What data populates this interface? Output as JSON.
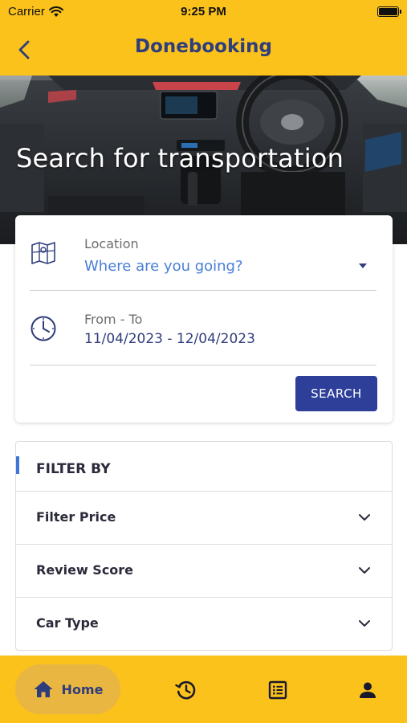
{
  "status_bar": {
    "carrier": "Carrier",
    "time": "9:25 PM"
  },
  "app_bar": {
    "title": "Donebooking",
    "back_icon": "chevron-left-icon"
  },
  "hero": {
    "title": "Search for transportation"
  },
  "search": {
    "location": {
      "label": "Location",
      "placeholder": "Where are you going?",
      "icon": "map-icon"
    },
    "dates": {
      "label": "From - To",
      "value": "11/04/2023 - 12/04/2023",
      "icon": "clock-icon"
    },
    "button_label": "SEARCH"
  },
  "filters": {
    "title": "FILTER BY",
    "items": [
      {
        "label": "Filter Price"
      },
      {
        "label": "Review Score"
      },
      {
        "label": "Car Type"
      }
    ]
  },
  "tabs": {
    "home_label": "Home",
    "icons": [
      "home-icon",
      "history-icon",
      "list-icon",
      "person-icon"
    ]
  },
  "colors": {
    "brand_yellow": "#fbc21b",
    "primary_navy": "#2f3d7c",
    "button_blue": "#2e3f9a",
    "link_blue": "#4a7fd8"
  }
}
